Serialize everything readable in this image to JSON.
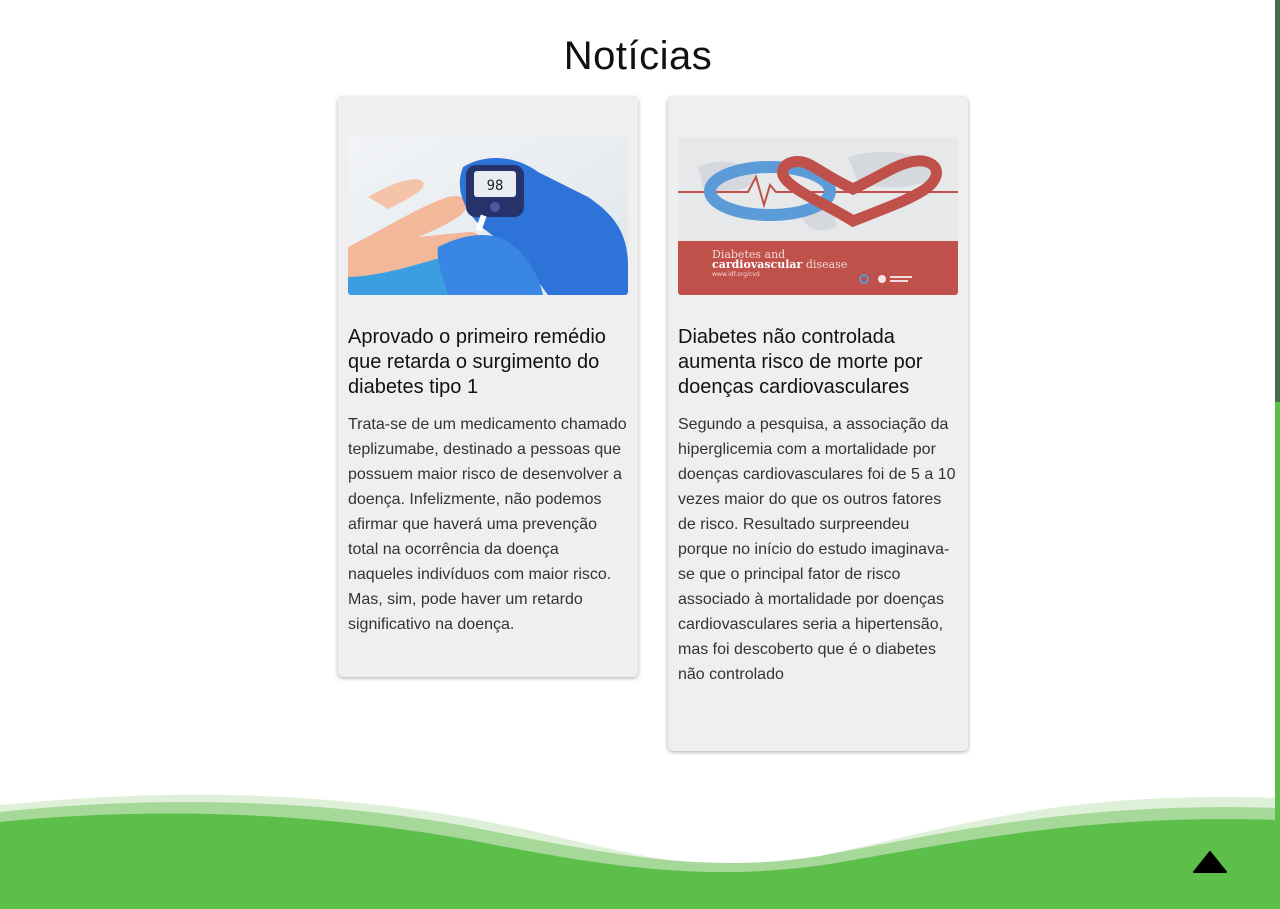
{
  "section": {
    "title": "Notícias"
  },
  "news": [
    {
      "title": "Aprovado o primeiro remédio que retarda o surgimento do diabetes tipo 1",
      "text": "Trata-se de um medicamento chamado teplizumabe, destinado a pessoas que possuem maior risco de desenvolver a doença. Infelizmente, não podemos afirmar que haverá uma prevenção total na ocorrência da doença naqueles indivíduos com maior risco. Mas, sim, pode haver um retardo significativo na doença.",
      "image": {
        "icon": "glucose-meter-photo",
        "meter_reading": "98"
      }
    },
    {
      "title": "Diabetes não controlada aumenta risco de morte por doenças cardiovasculares",
      "text": "Segundo a pesquisa, a associação da hiperglicemia com a mortalidade por doenças cardiovasculares foi de 5 a 10 vezes maior do que os outros fatores de risco. Resultado surpreendeu porque no início do estudo imaginava-se que o principal fator de risco associado à mortalidade por doenças cardiovasculares seria a hipertensão, mas foi descoberto que é o diabetes não controlado",
      "image": {
        "icon": "heart-circle-banner",
        "line1": "Diabetes and",
        "line2_bold": "cardiovascular",
        "line2_rest": " disease",
        "url": "www.idf.org/cvd"
      }
    }
  ],
  "colors": {
    "accent_green": "#5cbf4a",
    "card_bg": "#efefef",
    "banner_red": "#c0504a",
    "banner_blue": "#5b9bd8"
  },
  "back_to_top": {
    "icon": "triangle-up-icon"
  }
}
